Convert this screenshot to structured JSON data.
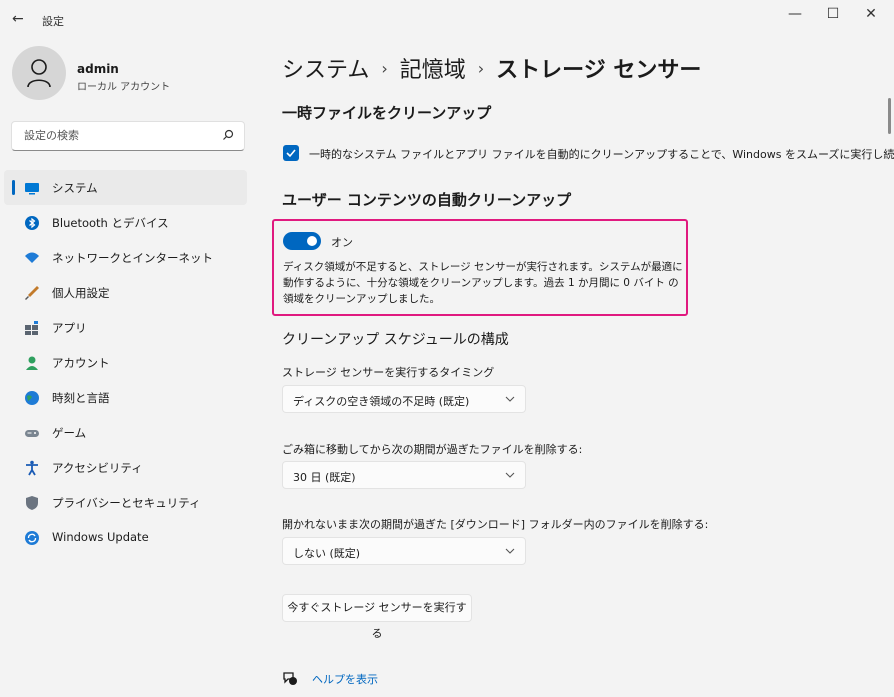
{
  "window": {
    "title": "設定",
    "controls": {
      "minimize": "—",
      "maximize": "☐",
      "close": "✕"
    }
  },
  "user": {
    "name": "admin",
    "account_type": "ローカル アカウント"
  },
  "search": {
    "placeholder": "設定の検索"
  },
  "nav": [
    {
      "label": "システム",
      "icon": "system-icon",
      "active": true,
      "color": "#0078d4"
    },
    {
      "label": "Bluetooth とデバイス",
      "icon": "bluetooth-icon",
      "color": "#0067c0"
    },
    {
      "label": "ネットワークとインターネット",
      "icon": "wifi-icon",
      "color": "#1e7bd6"
    },
    {
      "label": "個人用設定",
      "icon": "brush-icon",
      "color": "#c27a2a"
    },
    {
      "label": "アプリ",
      "icon": "apps-icon",
      "color": "#5a6470"
    },
    {
      "label": "アカウント",
      "icon": "account-icon",
      "color": "#2fa05f"
    },
    {
      "label": "時刻と言語",
      "icon": "globe-icon",
      "color": "#1e7bd6"
    },
    {
      "label": "ゲーム",
      "icon": "gamepad-icon",
      "color": "#7a8590"
    },
    {
      "label": "アクセシビリティ",
      "icon": "accessibility-icon",
      "color": "#1a5bb5"
    },
    {
      "label": "プライバシーとセキュリティ",
      "icon": "shield-icon",
      "color": "#6b7480"
    },
    {
      "label": "Windows Update",
      "icon": "update-icon",
      "color": "#1e7bd6"
    }
  ],
  "breadcrumb": {
    "level1": "システム",
    "sep": "›",
    "level2": "記憶域",
    "current": "ストレージ センサー"
  },
  "temp_cleanup": {
    "heading": "一時ファイルをクリーンアップ",
    "checkbox_label": "一時的なシステム ファイルとアプリ ファイルを自動的にクリーンアップすることで、Windows をスムーズに実行し続けます",
    "checked": true
  },
  "auto_cleanup": {
    "heading": "ユーザー コンテンツの自動クリーンアップ",
    "toggle_state": "オン",
    "toggle_on": true,
    "description": "ディスク領域が不足すると、ストレージ センサーが実行されます。システムが最適に動作するように、十分な領域をクリーンアップします。過去 1 か月間に 0 バイト の領域をクリーンアップしました。"
  },
  "schedule": {
    "heading": "クリーンアップ スケジュールの構成",
    "run_label": "ストレージ センサーを実行するタイミング",
    "run_value": "ディスクの空き領域の不足時 (既定)",
    "recycle_label": "ごみ箱に移動してから次の期間が過ぎたファイルを削除する:",
    "recycle_value": "30 日 (既定)",
    "downloads_label": "開かれないまま次の期間が過ぎた [ダウンロード] フォルダー内のファイルを削除する:",
    "downloads_value": "しない (既定)",
    "run_now_button": "今すぐストレージ センサーを実行する"
  },
  "help": {
    "label": "ヘルプを表示"
  },
  "colors": {
    "accent": "#0067c0",
    "highlight": "#e0197f"
  }
}
